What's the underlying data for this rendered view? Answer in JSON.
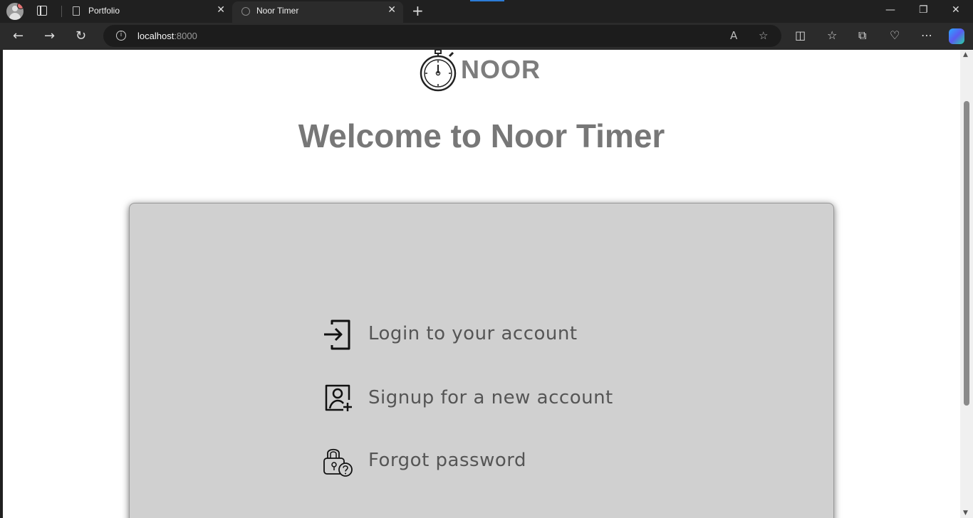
{
  "browser": {
    "tabs": [
      {
        "label": "Portfolio"
      },
      {
        "label": "Noor Timer"
      }
    ],
    "address": {
      "host": "localhost",
      "port": ":8000"
    }
  },
  "page": {
    "brand": "NOOR",
    "heading": "Welcome to Noor Timer",
    "options": [
      {
        "label": "Login to your account",
        "icon": "login-icon"
      },
      {
        "label": "Signup for a new account",
        "icon": "add-user-icon"
      },
      {
        "label": "Forgot password",
        "icon": "lock-question-icon"
      }
    ]
  }
}
